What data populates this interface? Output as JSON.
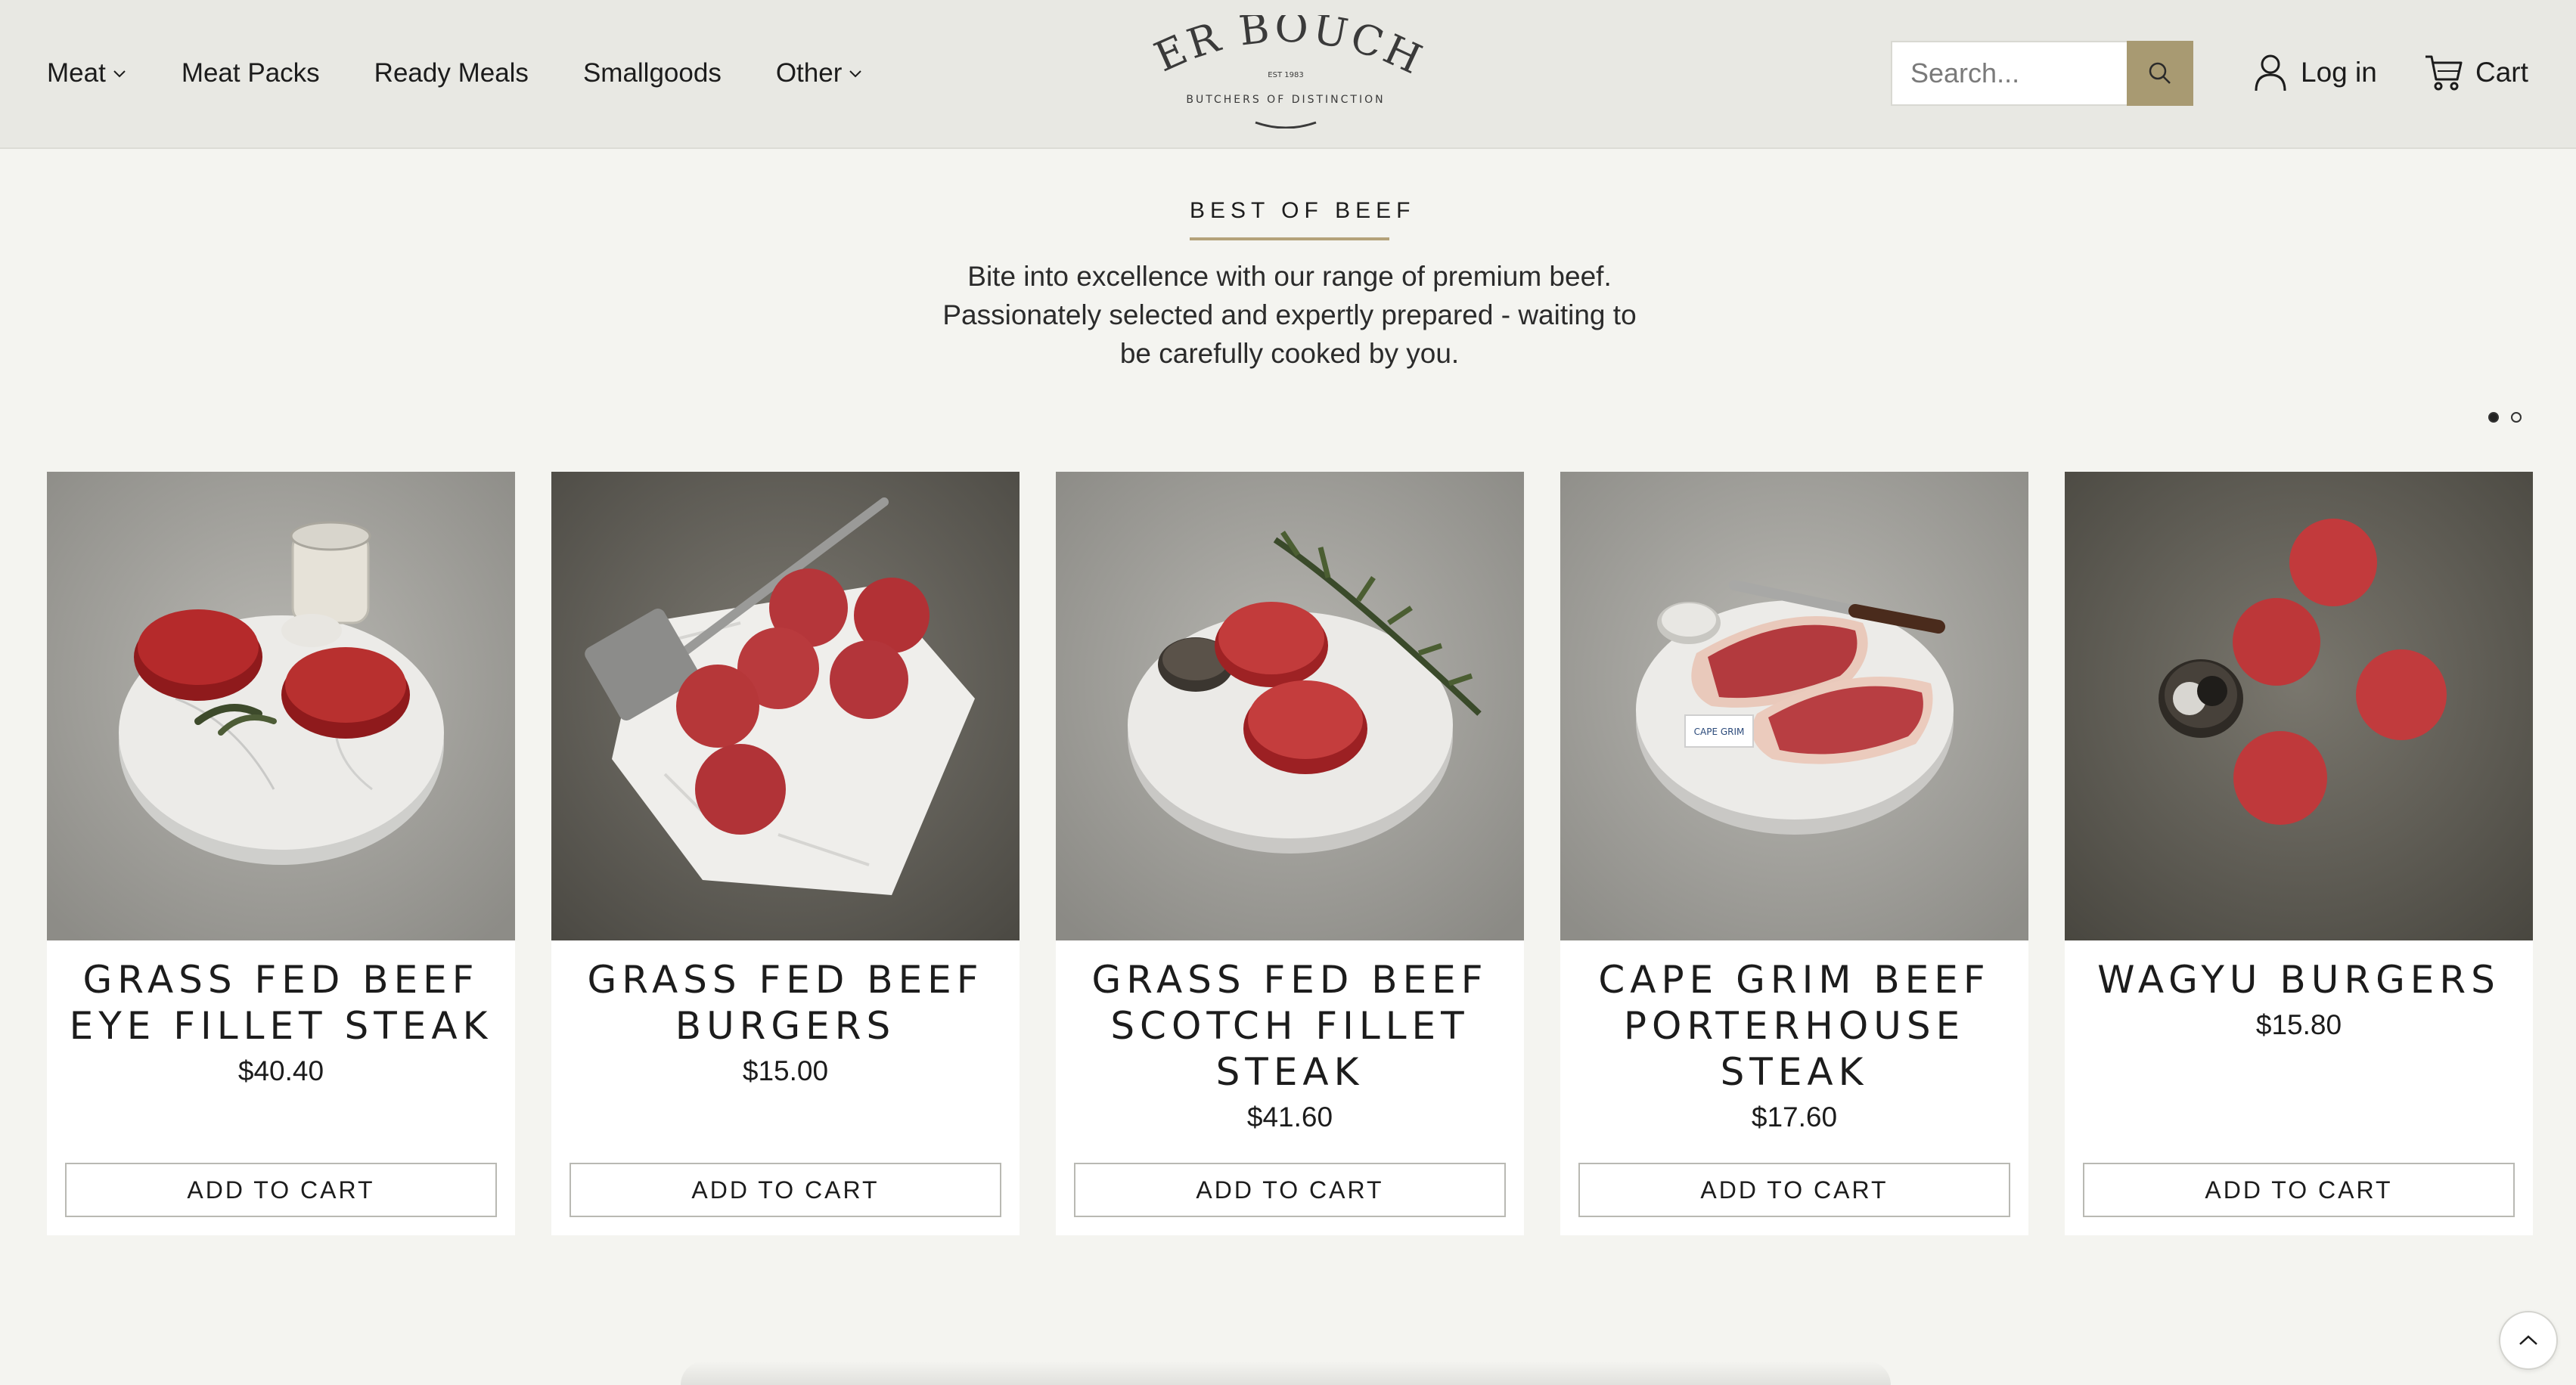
{
  "header": {
    "nav": [
      {
        "label": "Meat",
        "dropdown": true
      },
      {
        "label": "Meat Packs",
        "dropdown": false
      },
      {
        "label": "Ready Meals",
        "dropdown": false
      },
      {
        "label": "Smallgoods",
        "dropdown": false
      },
      {
        "label": "Other",
        "dropdown": true
      }
    ],
    "logo": {
      "name": "PETER BOUCHIER",
      "est": "EST 1983",
      "tagline": "BUTCHERS OF DISTINCTION"
    },
    "search_placeholder": "Search...",
    "login_label": "Log in",
    "cart_label": "Cart"
  },
  "hero": {
    "section_label": "BEST OF BEEF",
    "intro_lines": [
      "Bite into excellence with our range of premium beef.",
      "Passionately selected and expertly prepared - waiting to",
      "be carefully cooked by you."
    ],
    "slide_current": 1,
    "slide_total": 2
  },
  "products": [
    {
      "title": "GRASS FED BEEF EYE FILLET STEAK",
      "price": "$40.40",
      "button": "ADD TO CART",
      "image": "eye-fillet-steak"
    },
    {
      "title": "GRASS FED BEEF BURGERS",
      "price": "$15.00",
      "button": "ADD TO CART",
      "image": "beef-burgers"
    },
    {
      "title": "GRASS FED BEEF SCOTCH FILLET STEAK",
      "price": "$41.60",
      "button": "ADD TO CART",
      "image": "scotch-fillet-steak"
    },
    {
      "title": "CAPE GRIM BEEF PORTERHOUSE STEAK",
      "price": "$17.60",
      "button": "ADD TO CART",
      "image": "porterhouse-steak",
      "image_label": "CAPE GRIM"
    },
    {
      "title": "WAGYU BURGERS",
      "price": "$15.80",
      "button": "ADD TO CART",
      "image": "wagyu-burgers"
    }
  ],
  "colors": {
    "header_bg": "#e8e8e3",
    "page_bg": "#f4f4f0",
    "accent": "#a89a72",
    "underline": "#b4a27a"
  }
}
